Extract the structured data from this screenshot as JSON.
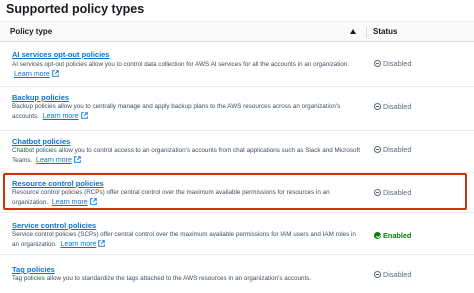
{
  "panel": {
    "title": "Supported policy types"
  },
  "table": {
    "columns": {
      "policy": "Policy type",
      "status": "Status"
    },
    "learn_more": "Learn more",
    "rows": [
      {
        "name": "AI services opt-out policies",
        "description": "AI services opt-out policies allow you to control data collection for AWS AI services for all the accounts in an organization.",
        "status": "Disabled"
      },
      {
        "name": "Backup policies",
        "description": "Backup policies allow you to centrally manage and apply backup plans to the AWS resources across an organization's accounts.",
        "status": "Disabled"
      },
      {
        "name": "Chatbot policies",
        "description": "Chatbot policies allow you to control access to an organization's accounts from chat applications such as Slack and Microsoft Teams.",
        "status": "Disabled"
      },
      {
        "name": "Resource control policies",
        "description": "Resource control policies (RCPs) offer central control over the maximum available permissions for resources in an organization.",
        "status": "Disabled"
      },
      {
        "name": "Service control policies",
        "description": "Service control policies (SCPs) offer central control over the maximum available permissions for IAM users and IAM roles in an organization.",
        "status": "Enabled"
      },
      {
        "name": "Tag policies",
        "description": "Tag policies allow you to standardize the tags attached to the AWS resources in an organization's accounts.",
        "status": "Disabled"
      }
    ]
  },
  "colors": {
    "link": "#0972d3",
    "enabled": "#037f0c",
    "disabled": "#5f6b7a",
    "highlight": "#d13212"
  }
}
